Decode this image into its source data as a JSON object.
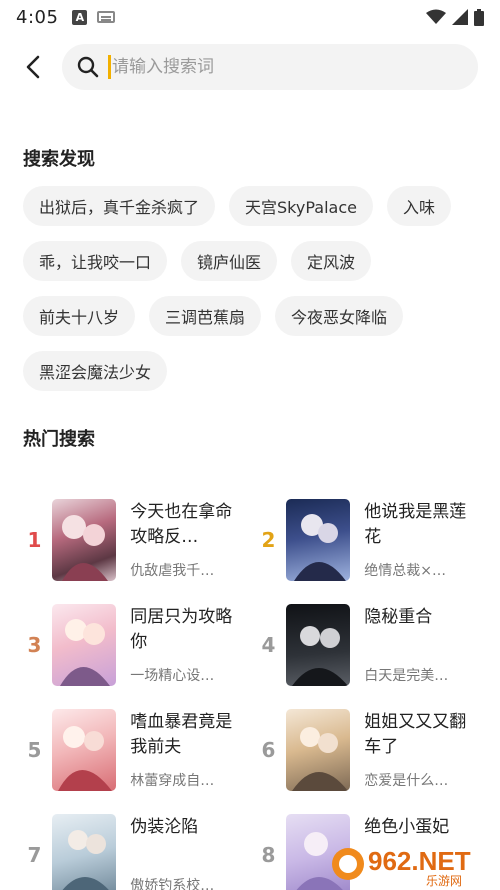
{
  "status_bar": {
    "time": "4:05"
  },
  "search": {
    "placeholder": "请输入搜索词"
  },
  "discover": {
    "title": "搜索发现",
    "rows": [
      [
        "出狱后，真千金杀疯了",
        "天宫SkyPalace",
        "入味"
      ],
      [
        "乖，让我咬一口",
        "镜庐仙医",
        "定风波"
      ],
      [
        "前夫十八岁",
        "三调芭蕉扇",
        "今夜恶女降临"
      ],
      [
        "黑涩会魔法少女"
      ]
    ]
  },
  "hot": {
    "title": "热门搜索",
    "items": [
      {
        "rank": "1",
        "name": "今天也在拿命攻略反…",
        "desc": "仇敌虐我千…"
      },
      {
        "rank": "2",
        "name": "他说我是黑莲花",
        "desc": "绝情总裁×…"
      },
      {
        "rank": "3",
        "name": "同居只为攻略你",
        "desc": "一场精心设…"
      },
      {
        "rank": "4",
        "name": "隐秘重合",
        "desc": "白天是完美…"
      },
      {
        "rank": "5",
        "name": "嗜血暴君竟是我前夫",
        "desc": "林蕾穿成自…"
      },
      {
        "rank": "6",
        "name": "姐姐又又又翻车了",
        "desc": "恋爱是什么…"
      },
      {
        "rank": "7",
        "name": "伪装沦陷",
        "desc": "傲娇钓系校…"
      },
      {
        "rank": "8",
        "name": "绝色小蛋妃",
        "desc": ""
      }
    ]
  },
  "watermark": {
    "text": "962.NET",
    "sub": "乐游网"
  }
}
